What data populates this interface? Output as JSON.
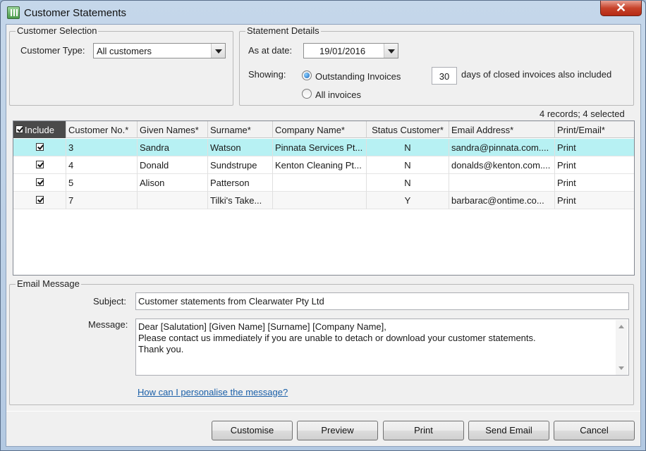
{
  "window": {
    "title": "Customer Statements",
    "close_glyph": "✕"
  },
  "customer_selection": {
    "title": "Customer Selection",
    "type_label": "Customer Type:",
    "type_value": "All customers"
  },
  "statement_details": {
    "title": "Statement Details",
    "date_label": "As at date:",
    "date_value": "19/01/2016",
    "showing_label": "Showing:",
    "option_outstanding": "Outstanding Invoices",
    "option_all": "All invoices",
    "selected_option": "Outstanding Invoices",
    "days_value": "30",
    "days_suffix": "days of closed invoices also included"
  },
  "grid": {
    "summary": "4 records;  4 selected",
    "columns": [
      "Include",
      "Customer No.*",
      "Given Names*",
      "Surname*",
      "Company Name*",
      "Status Customer*",
      "Email Address*",
      "Print/Email*"
    ],
    "rows": [
      {
        "include": true,
        "customer_no": "3",
        "given_names": "Sandra",
        "surname": "Watson",
        "company": "Pinnata Services Pt...",
        "status": "N",
        "email": "sandra@pinnata.com....",
        "print_email": "Print",
        "selected": true
      },
      {
        "include": true,
        "customer_no": "4",
        "given_names": "Donald",
        "surname": "Sundstrupe",
        "company": "Kenton Cleaning Pt...",
        "status": "N",
        "email": "donalds@kenton.com....",
        "print_email": "Print",
        "selected": false
      },
      {
        "include": true,
        "customer_no": "5",
        "given_names": "Alison",
        "surname": "Patterson",
        "company": "",
        "status": "N",
        "email": "",
        "print_email": "Print",
        "selected": false
      },
      {
        "include": true,
        "customer_no": "7",
        "given_names": "",
        "surname": "Tilki's Take...",
        "company": "",
        "status": "Y",
        "email": "barbarac@ontime.co...",
        "print_email": "Print",
        "selected": false
      }
    ]
  },
  "email": {
    "title": "Email Message",
    "subject_label": "Subject:",
    "subject_value": "Customer statements from Clearwater Pty Ltd",
    "message_label": "Message:",
    "message_lines": [
      "Dear [Salutation] [Given Name] [Surname] [Company Name],",
      "Please contact us immediately if you are unable to detach or download your customer statements.",
      "Thank you."
    ],
    "help_link": "How can I personalise the message?"
  },
  "buttons": {
    "customise": "Customise",
    "preview": "Preview",
    "print": "Print",
    "send_email": "Send Email",
    "cancel": "Cancel"
  }
}
